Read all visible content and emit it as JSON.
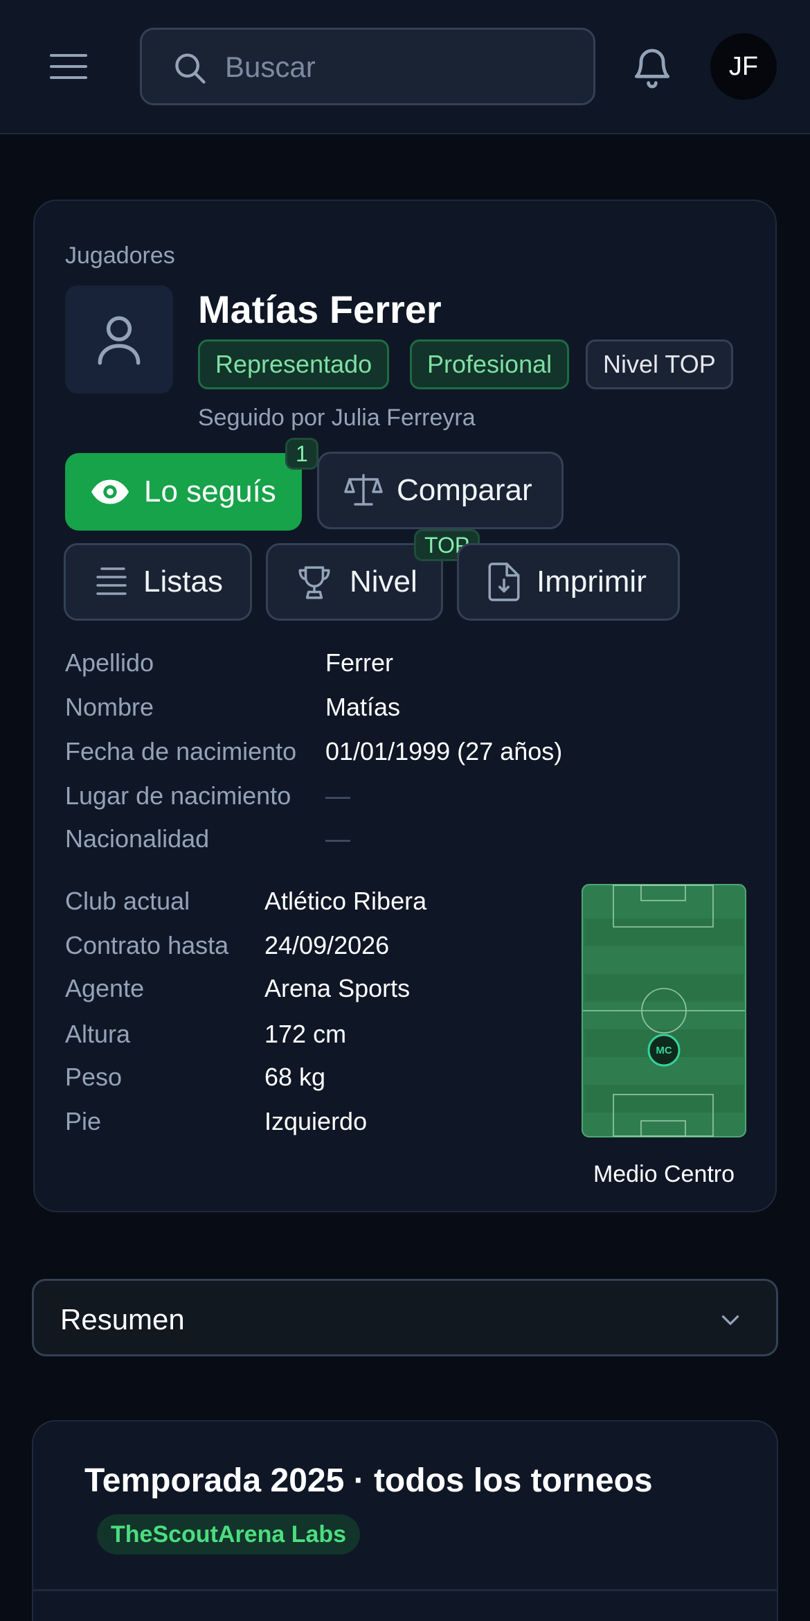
{
  "header": {
    "search_placeholder": "Buscar",
    "user_initials": "JF"
  },
  "profile": {
    "breadcrumb": "Jugadores",
    "name": "Matías Ferrer",
    "badges": [
      "Representado",
      "Profesional",
      "Nivel TOP"
    ],
    "followed_by": "Seguido por Julia Ferreyra",
    "actions": {
      "follow_label": "Lo seguís",
      "follow_count": "1",
      "compare_label": "Comparar",
      "lists_label": "Listas",
      "level_label": "Nivel",
      "level_badge": "TOP",
      "print_label": "Imprimir"
    },
    "personal": [
      {
        "label": "Apellido",
        "value": "Ferrer"
      },
      {
        "label": "Nombre",
        "value": "Matías"
      },
      {
        "label": "Fecha de nacimiento",
        "value": "01/01/1999 (27 años)"
      },
      {
        "label": "Lugar de nacimiento",
        "value": "—"
      },
      {
        "label": "Nacionalidad",
        "value": "—"
      }
    ],
    "club": [
      {
        "label": "Club actual",
        "value": "Atlético Ribera"
      },
      {
        "label": "Contrato hasta",
        "value": "24/09/2026"
      },
      {
        "label": "Agente",
        "value": "Arena Sports"
      },
      {
        "label": "Altura",
        "value": "172 cm"
      },
      {
        "label": "Peso",
        "value": "68 kg"
      },
      {
        "label": "Pie",
        "value": "Izquierdo"
      }
    ],
    "position": {
      "code": "MC",
      "label": "Medio Centro"
    }
  },
  "summary": {
    "label": "Resumen"
  },
  "season": {
    "title": "Temporada 2025 · todos los torneos",
    "source": "TheScoutArena Labs"
  },
  "colors": {
    "primary": "#16a34a",
    "background": "#080c14",
    "card": "#0f1726",
    "badge_green_text": "#7ee0a3",
    "pitch_green": "#2f7d4f"
  },
  "icons": {
    "menu": "hamburger-icon",
    "search": "search-icon",
    "notifications": "bell-icon",
    "photo_placeholder": "user-icon",
    "follow": "eye-icon",
    "compare": "scale-icon",
    "lists": "list-icon",
    "level": "trophy-icon",
    "print": "file-download-icon",
    "expand": "chevron-down-icon"
  }
}
